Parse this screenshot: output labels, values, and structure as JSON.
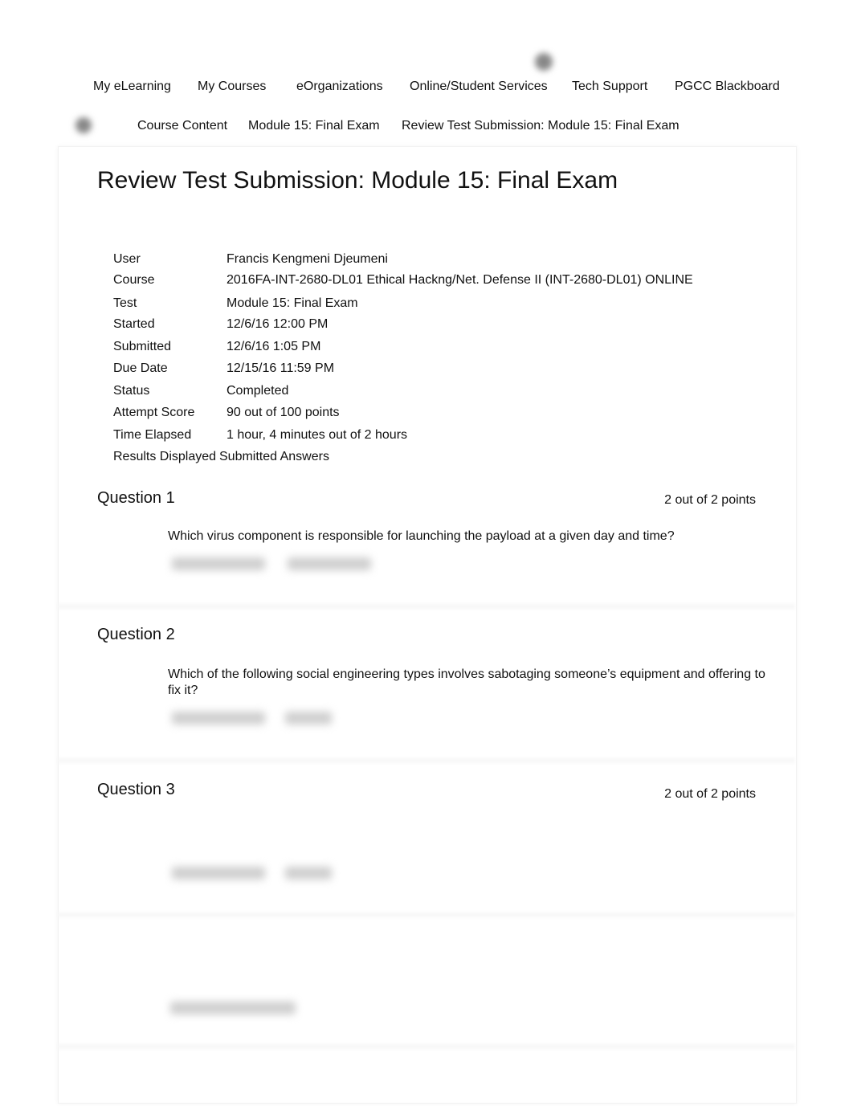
{
  "nav": [
    "My eLearning",
    "My Courses",
    "eOrganizations",
    "Online/Student Services",
    "Tech Support",
    "PGCC Blackboard"
  ],
  "breadcrumb": [
    "Course Content",
    "Module 15: Final Exam",
    "Review Test Submission: Module 15: Final Exam"
  ],
  "page_title": "Review Test Submission: Module 15: Final Exam",
  "details": [
    {
      "label": "User",
      "value": "Francis Kengmeni Djeumeni"
    },
    {
      "label": "Course",
      "value": "2016FA-INT-2680-DL01 Ethical Hackng/Net. Defense II (INT-2680-DL01) ONLINE"
    },
    {
      "label": "Test",
      "value": "Module 15: Final Exam"
    },
    {
      "label": "Started",
      "value": "12/6/16 12:00 PM"
    },
    {
      "label": "Submitted",
      "value": "12/6/16 1:05 PM"
    },
    {
      "label": "Due Date",
      "value": "12/15/16 11:59 PM"
    },
    {
      "label": "Status",
      "value": "Completed"
    },
    {
      "label": "Attempt Score",
      "value": "90 out of 100 points"
    },
    {
      "label": "Time Elapsed",
      "value": "1 hour, 4 minutes out of 2 hours"
    },
    {
      "label": "Results Displayed",
      "value": "Submitted Answers"
    }
  ],
  "questions": [
    {
      "title": "Question 1",
      "points": "2 out of 2 points",
      "text": "Which virus component is responsible for launching the payload at a given day and time?"
    },
    {
      "title": "Question 2",
      "points": "",
      "text": "Which of the following social engineering types involves sabotaging someone’s equipment and offering to fix it?"
    },
    {
      "title": "Question 3",
      "points": "2 out of 2 points",
      "text": ""
    }
  ]
}
